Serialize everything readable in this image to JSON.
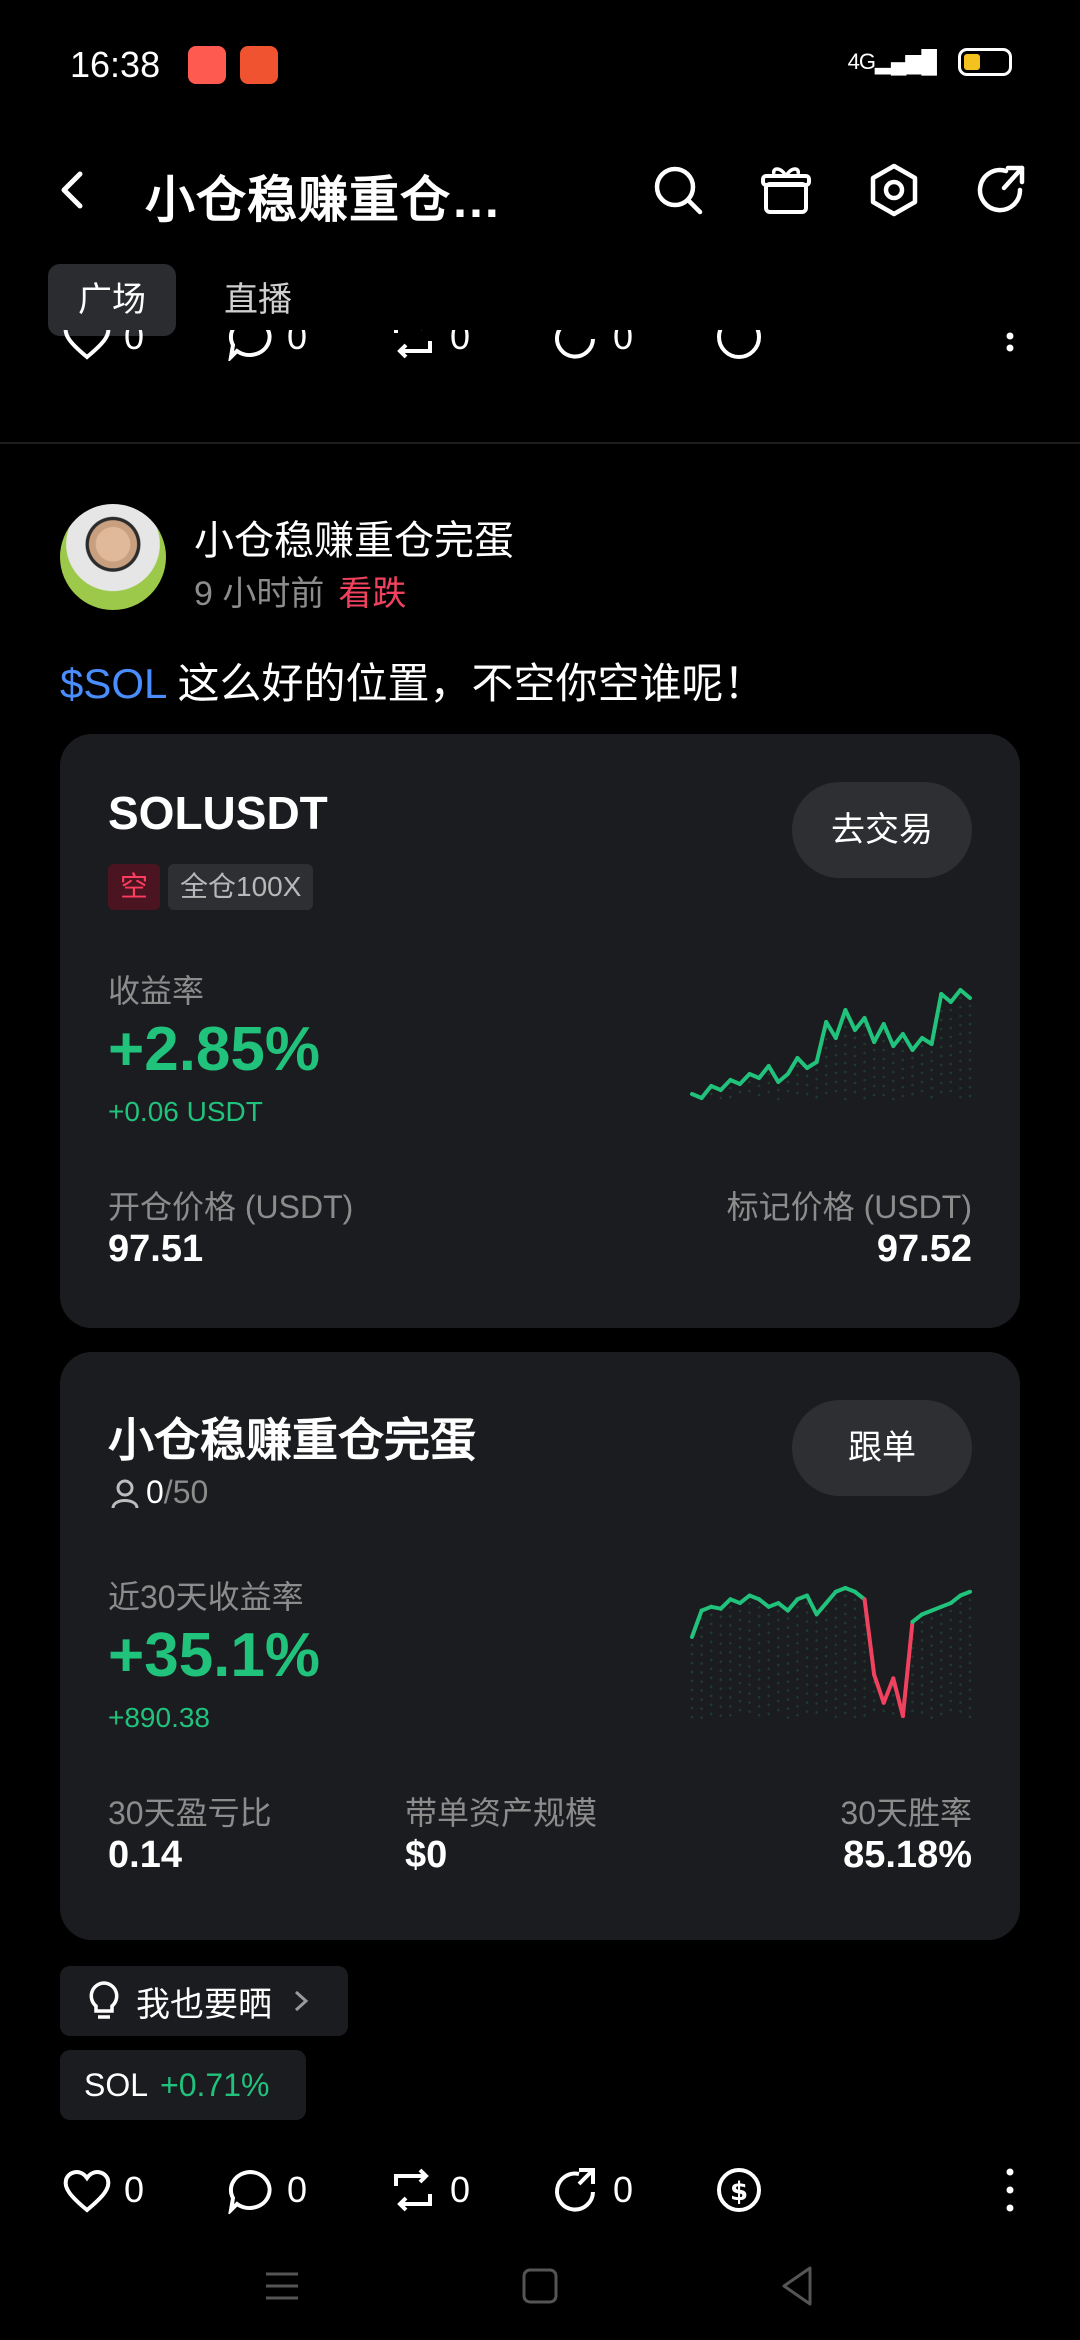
{
  "status_bar": {
    "time": "16:38",
    "network": "4G"
  },
  "header": {
    "title": "小仓稳赚重仓…"
  },
  "tabs": [
    {
      "label": "广场",
      "active": true
    },
    {
      "label": "直播",
      "active": false
    }
  ],
  "prev_post_counts": {
    "likes": "0",
    "comments": "0",
    "reposts": "0",
    "shares": "0"
  },
  "post": {
    "author": "小仓稳赚重仓完蛋",
    "time": "9 小时前",
    "sentiment": "看跌",
    "ticker": "$SOL",
    "text": " 这么好的位置，不空你空谁呢！"
  },
  "position_card": {
    "symbol": "SOLUSDT",
    "direction_badge": "空",
    "margin_badge": "全仓100X",
    "trade_button": "去交易",
    "return_label": "收益率",
    "return_pct": "+2.85%",
    "return_amount": "+0.06 USDT",
    "open_price_label": "开仓价格 (USDT)",
    "open_price": "97.51",
    "mark_price_label": "标记价格 (USDT)",
    "mark_price": "97.52",
    "sparkline": [
      20,
      18,
      24,
      22,
      27,
      25,
      30,
      28,
      34,
      26,
      30,
      38,
      33,
      36,
      56,
      48,
      62,
      52,
      58,
      46,
      55,
      44,
      50,
      42,
      48,
      45,
      70,
      66,
      72,
      68
    ]
  },
  "copy_card": {
    "name": "小仓稳赚重仓完蛋",
    "followers": "0",
    "followers_max": "/50",
    "follow_button": "跟单",
    "return_label": "近30天收益率",
    "return_pct": "+35.1%",
    "return_amount": "+890.38",
    "stat1_label": "30天盈亏比",
    "stat1_value": "0.14",
    "stat2_label": "带单资产规模",
    "stat2_value": "$0",
    "stat3_label": "30天胜率",
    "stat3_value": "85.18%",
    "sparkline": [
      40,
      54,
      56,
      55,
      60,
      58,
      62,
      60,
      56,
      58,
      54,
      60,
      62,
      52,
      58,
      64,
      66,
      64,
      60,
      20,
      5,
      18,
      -2,
      48,
      52,
      54,
      56,
      58,
      62,
      64
    ]
  },
  "share_button": {
    "label": "我也要晒"
  },
  "price_tag": {
    "symbol": "SOL",
    "change": "+0.71%"
  },
  "actions": {
    "likes": "0",
    "comments": "0",
    "reposts": "0",
    "shares": "0"
  },
  "colors": {
    "green": "#21c27c",
    "red": "#f0425f",
    "link": "#4a8dff",
    "card_bg": "#1b1c1f"
  }
}
